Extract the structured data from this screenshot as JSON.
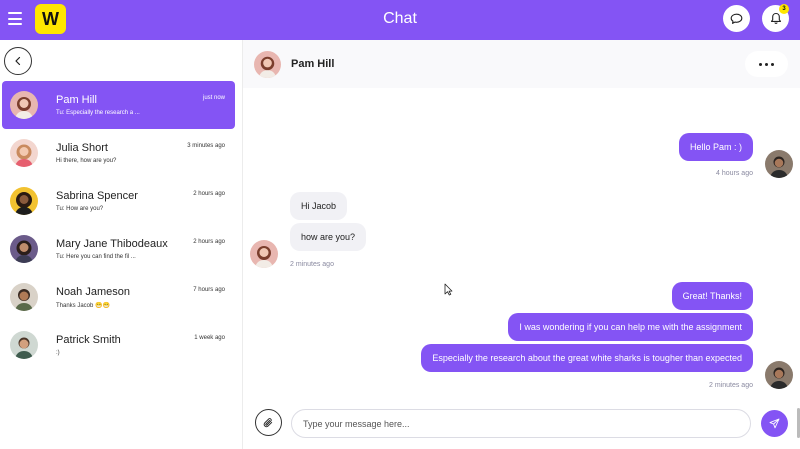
{
  "app": {
    "title": "Chat",
    "logo_letter": "W",
    "notification_count": "3",
    "brand_color": "#8454f4",
    "logo_color": "#ffe600",
    "icons": [
      "menu-icon",
      "chat-bubble-icon",
      "bell-icon",
      "chevron-left-icon",
      "paperclip-icon",
      "send-icon",
      "more-icon"
    ]
  },
  "conversations": [
    {
      "name": "Pam Hill",
      "time": "just now",
      "preview": "Tu: Especially the research a ..."
    },
    {
      "name": "Julia Short",
      "time": "3 minutes ago",
      "preview": "Hi there, how are you?"
    },
    {
      "name": "Sabrina Spencer",
      "time": "2 hours ago",
      "preview": "Tu: How are you?"
    },
    {
      "name": "Mary Jane Thibodeaux",
      "time": "2 hours ago",
      "preview": "Tu: Here you can find the fil ..."
    },
    {
      "name": "Noah Jameson",
      "time": "7 hours ago",
      "preview": "Thanks Jacob 😁😁"
    },
    {
      "name": "Patrick Smith",
      "time": "1 week ago",
      "preview": ":)"
    }
  ],
  "chat": {
    "contact_name": "Pam Hill",
    "messages": [
      {
        "text": "Hello Pam : )"
      },
      {
        "text": "Hi Jacob"
      },
      {
        "text": "how are you?"
      },
      {
        "text": "Great! Thanks!"
      },
      {
        "text": "I was wondering if you can help me with the assignment"
      },
      {
        "text": "Especially the research about the great white sharks is tougher than expected"
      }
    ],
    "timestamps": [
      "4 hours ago",
      "2 minutes ago",
      "2 minutes ago"
    ]
  },
  "composer": {
    "placeholder": "Type your message here..."
  }
}
